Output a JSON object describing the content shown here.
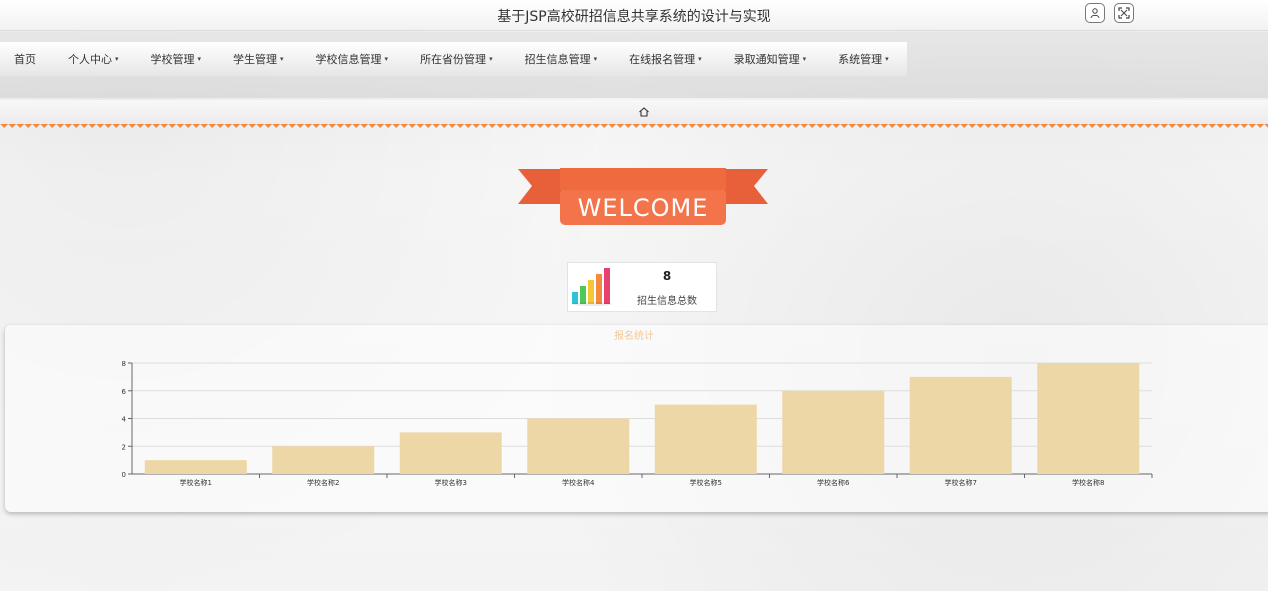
{
  "window": {
    "title": "基于JSP高校研招信息共享系统的设计与实现"
  },
  "header_icons": {
    "user": "user-icon",
    "fullscreen": "fullscreen-icon"
  },
  "nav": {
    "items": [
      {
        "label": "首页",
        "dropdown": false
      },
      {
        "label": "个人中心",
        "dropdown": true
      },
      {
        "label": "学校管理",
        "dropdown": true
      },
      {
        "label": "学生管理",
        "dropdown": true
      },
      {
        "label": "学校信息管理",
        "dropdown": true
      },
      {
        "label": "所在省份管理",
        "dropdown": true
      },
      {
        "label": "招生信息管理",
        "dropdown": true
      },
      {
        "label": "在线报名管理",
        "dropdown": true
      },
      {
        "label": "录取通知管理",
        "dropdown": true
      },
      {
        "label": "系统管理",
        "dropdown": true
      }
    ],
    "caret": "▾"
  },
  "welcome": {
    "text": "WELCOME"
  },
  "stat": {
    "value": "8",
    "label": "招生信息总数",
    "icon": "bar-chart-icon"
  },
  "colors": {
    "accent": "#f58a3d",
    "bar": "#eed7a6",
    "ribbon": "#ef6a3e"
  },
  "chart_data": {
    "type": "bar",
    "title": "报名统计",
    "categories": [
      "学校名称1",
      "学校名称2",
      "学校名称3",
      "学校名称4",
      "学校名称5",
      "学校名称6",
      "学校名称7",
      "学校名称8"
    ],
    "values": [
      1,
      2,
      3,
      4,
      5,
      6,
      7,
      8
    ],
    "yticks": [
      "0",
      "2",
      "4",
      "6",
      "8"
    ],
    "ylim": [
      0,
      8
    ],
    "grid": true
  }
}
